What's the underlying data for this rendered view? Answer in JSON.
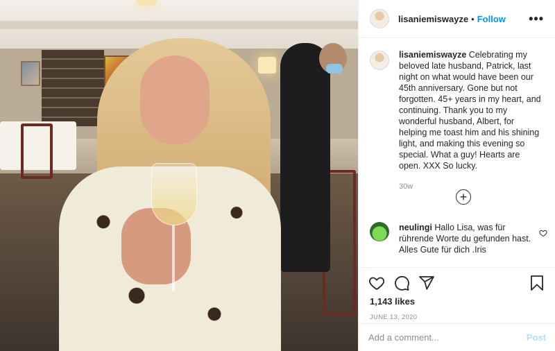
{
  "post": {
    "username": "lisaniemiswayze",
    "follow_label": "Follow",
    "separator": "•",
    "more_label": "•••",
    "caption": "Celebrating my beloved late husband, Patrick, last night on what would have been our 45th anniversary. Gone but not forgotten. 45+ years in my heart, and continuing. Thank you to my wonderful husband, Albert, for helping me toast him and his shining light, and making this evening so special. What a guy! Hearts are open. XXX So lucky.",
    "age": "30w",
    "load_more_label": "+"
  },
  "comment": {
    "username": "neulingi",
    "text": "Hallo Lisa, was für rührende Worte du gefunden hast. Alles Gute für dich .Iris"
  },
  "actions": {
    "like_icon": "heart-icon",
    "comment_icon": "comment-icon",
    "share_icon": "share-icon",
    "save_icon": "bookmark-icon"
  },
  "likes": "1,143 likes",
  "date": "JUNE 13, 2020",
  "add_comment": {
    "placeholder": "Add a comment...",
    "post_label": "Post"
  },
  "colors": {
    "accent": "#0095f6",
    "post_disabled": "#b2dffc",
    "muted": "#8e8e8e"
  }
}
